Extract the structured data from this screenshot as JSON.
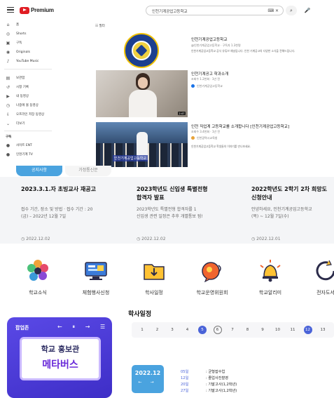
{
  "youtube": {
    "logo_text": "Premium",
    "search_query": "인천기계공업고등학교",
    "search_icons": "⌨ ✕",
    "search_button_icon": "⌕",
    "mic_icon": "🎤",
    "filter_label": "☷ 필터",
    "sidebar": {
      "items_top": [
        {
          "icon": "⌂",
          "label": "홈"
        },
        {
          "icon": "◎",
          "label": "Shorts"
        },
        {
          "icon": "▣",
          "label": "구독"
        },
        {
          "icon": "◉",
          "label": "Originals"
        },
        {
          "icon": "♪",
          "label": "YouTube Music"
        }
      ],
      "items_mid": [
        {
          "icon": "▤",
          "label": "보관함"
        },
        {
          "icon": "↺",
          "label": "시청 기록"
        },
        {
          "icon": "▶",
          "label": "내 동영상"
        },
        {
          "icon": "◷",
          "label": "나중에 볼 동영상"
        },
        {
          "icon": "⇩",
          "label": "오프라인 저장 동영상"
        },
        {
          "icon": "⌄",
          "label": "더보기"
        }
      ],
      "subs_heading": "구독",
      "subs": [
        {
          "icon": "●",
          "label": "사이트 ENT"
        },
        {
          "icon": "●",
          "label": "인천기계 TV"
        }
      ]
    },
    "results": [
      {
        "title": "인천기계공업고등학교",
        "meta": "@인천기계공업고등학교 · 구독자 1.3천명",
        "desc": "인천기계공업고등학교 공식 유튜브 채널입니다. 인천 기계공고의 다양한 소식을 전해드립니다."
      },
      {
        "title": "인천기계공고 학과소개",
        "meta": "조회수 1.2천회 · 1년 전",
        "channel": "인천기계공업고등학교",
        "duration": "2:47"
      },
      {
        "title": "인천 직업계 고등학교를 소개합니다 [인천기계공업고등학교]",
        "meta": "조회수 3.4천회 · 1년 전",
        "channel": "인천광역시교육청",
        "desc": "인천기계공업고등학교 학생들의 이야기를 만나보세요.",
        "caption": "인천기계공업고등학교"
      }
    ]
  },
  "school": {
    "tabs": {
      "active": "공지사항",
      "inactive": "가정통신문"
    },
    "notices": [
      {
        "title": "2023.3.1.자 초빙교사 재공고",
        "body": [
          "접수 기간, 장소 및 방법 · 접수 기간 : 20",
          "(금) – 2022년 12월 7일"
        ],
        "date": "2022.12.02"
      },
      {
        "title": "2023학년도 신입생 특별전형",
        "title2": "합격자 발표",
        "body": [
          "2023학년도 특별전형 합격자를 1",
          "신입생 관련 일정은 추후 개별통보 됨!"
        ],
        "date": "2022.12.02"
      },
      {
        "title": "2022학년도 2학기 2차 희망도",
        "title2": "신청안내",
        "body": [
          "안녕하세요, 인천기계공업고등학교",
          "(목) ~ 12월 7일(수)"
        ],
        "date": "2022.12.01"
      }
    ],
    "date_icon": "◷",
    "quick_links": [
      {
        "label": "학교소식"
      },
      {
        "label": "체험행사신청"
      },
      {
        "label": "학사일정"
      },
      {
        "label": "학교운영위원회"
      },
      {
        "label": "학교알리미"
      },
      {
        "label": "전자도서"
      }
    ],
    "banner": {
      "top_label": "팝업존",
      "controls": "← ⏸ → ☰",
      "line1": "학교 홍보관",
      "line2": "메타버스"
    },
    "calendar": {
      "title": "학사일정",
      "days": [
        "1",
        "2",
        "3",
        "4",
        "5",
        "6",
        "7",
        "8",
        "9",
        "10",
        "11",
        "12",
        "13"
      ],
      "selected_days": [
        "5",
        "12"
      ],
      "ring_days": [
        "6"
      ],
      "month_label": "2022.12",
      "month_nav": "← →",
      "events": [
        {
          "day": "05일",
          "name": ": 균형잡수업"
        },
        {
          "day": "12일",
          "name": ": 졸업사진촬영"
        },
        {
          "day": "20일",
          "name": ": 기말고사(1,2학년)"
        },
        {
          "day": "27일",
          "name": ": 기말고사(1,2학년)"
        }
      ]
    }
  }
}
